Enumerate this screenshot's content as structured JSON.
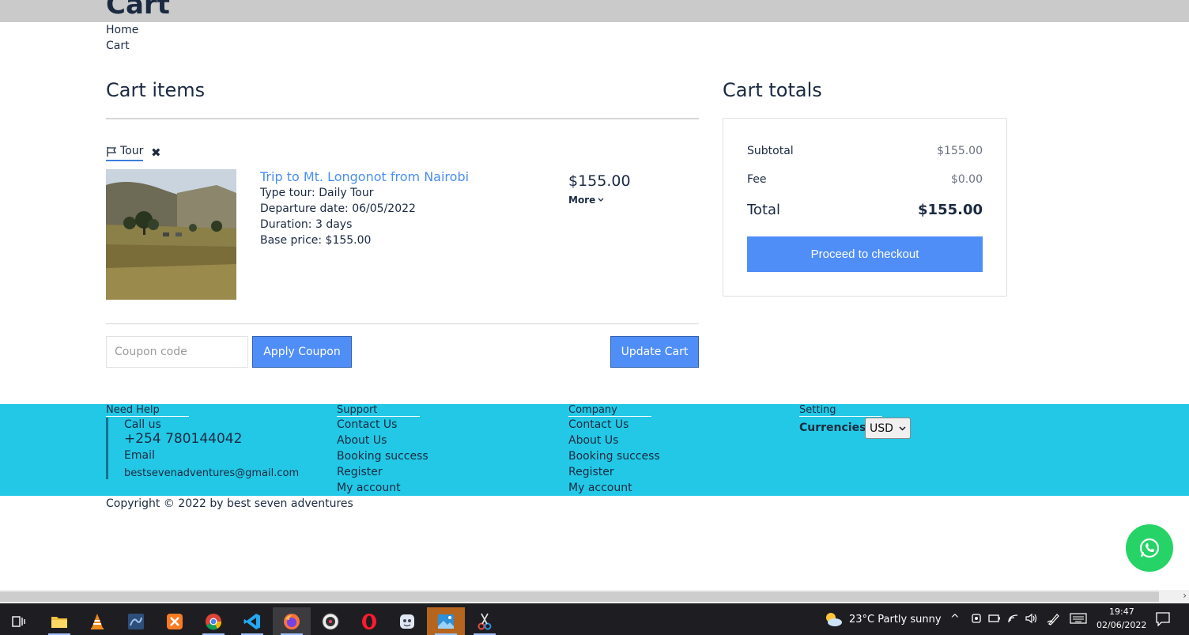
{
  "header": {
    "title": "Cart",
    "breadcrumb": [
      "Home",
      "Cart"
    ]
  },
  "cart_items": {
    "heading": "Cart items",
    "tag": "Tour",
    "item": {
      "title": "Trip to Mt. Longonot from Nairobi",
      "type_tour": "Type tour: Daily Tour",
      "departure": "Departure date: 06/05/2022",
      "duration": "Duration: 3 days",
      "base_price": "Base price: $155.00",
      "price": "$155.00",
      "more_label": "More"
    },
    "coupon_placeholder": "Coupon code",
    "apply_coupon_label": "Apply Coupon",
    "update_cart_label": "Update Cart"
  },
  "cart_totals": {
    "heading": "Cart totals",
    "subtotal_label": "Subtotal",
    "subtotal_value": "$155.00",
    "fee_label": "Fee",
    "fee_value": "$0.00",
    "total_label": "Total",
    "total_value": "$155.00",
    "checkout_label": "Proceed to checkout"
  },
  "footer": {
    "need_help": {
      "heading": "Need Help",
      "call_label": "Call us",
      "phone": "+254 780144042",
      "email_label": "Email",
      "email": "bestsevenadventures@gmail.com"
    },
    "support": {
      "heading": "Support",
      "links": [
        "Contact Us",
        "About Us",
        "Booking success",
        "Register",
        "My account"
      ]
    },
    "company": {
      "heading": "Company",
      "links": [
        "Contact Us",
        "About Us",
        "Booking success",
        "Register",
        "My account"
      ]
    },
    "setting": {
      "heading": "Setting",
      "currency_label": "Currencies",
      "currency_value": "USD"
    },
    "copyright": "Copyright © 2022 by best seven adventures"
  },
  "taskbar": {
    "weather": "23°C  Partly sunny",
    "time": "19:47",
    "date": "02/06/2022"
  },
  "colors": {
    "accent": "#4f8ef7",
    "footer_bg": "#22c8e5",
    "whatsapp": "#25d366",
    "text": "#1b2a41"
  }
}
